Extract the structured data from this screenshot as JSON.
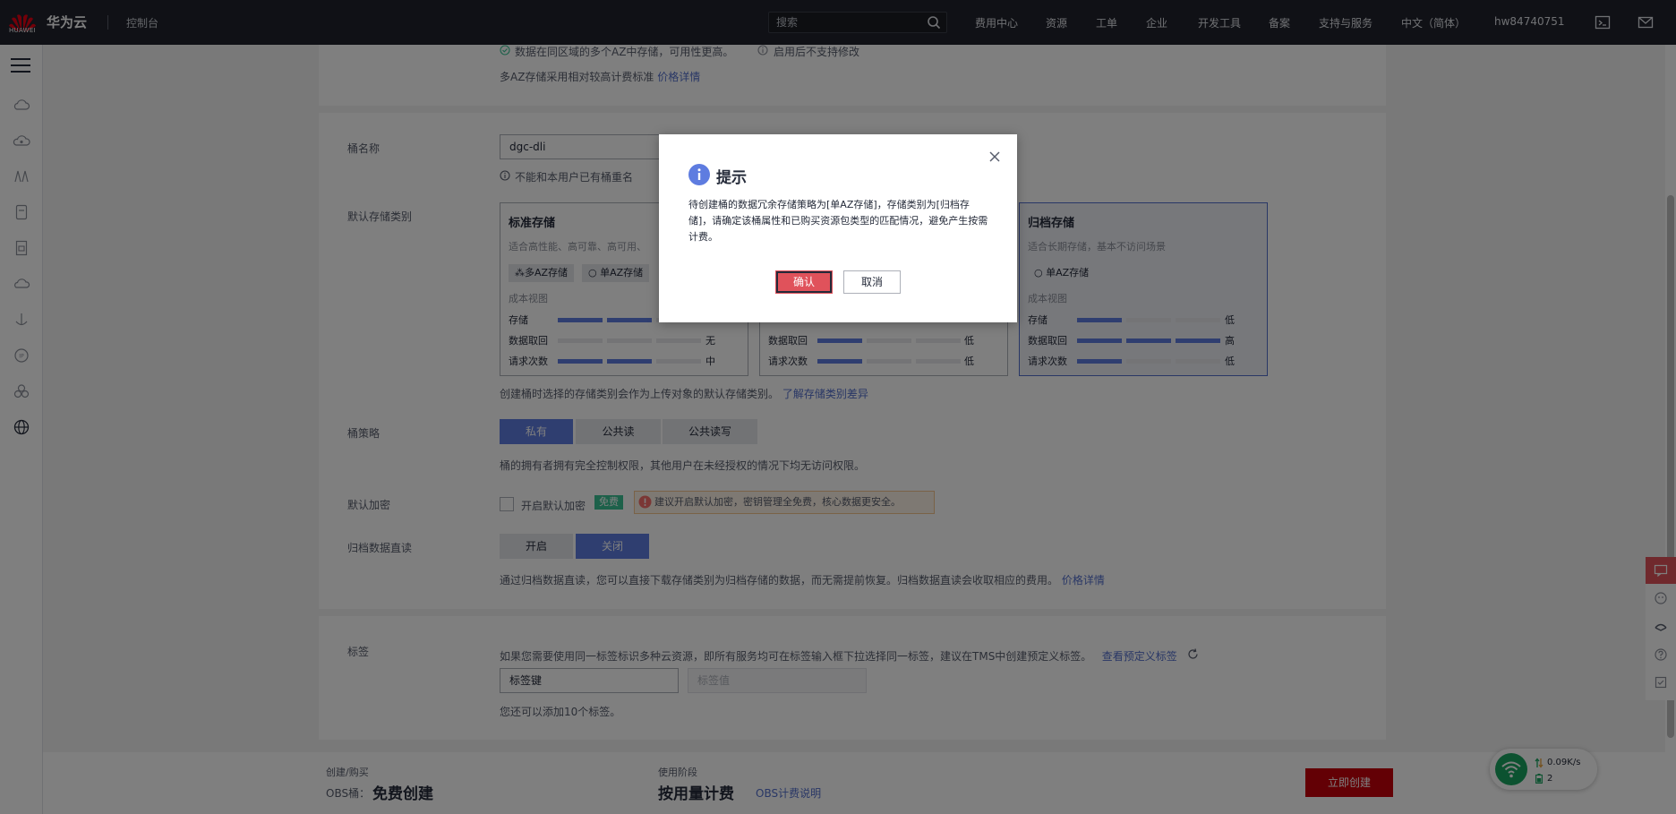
{
  "topbar": {
    "brand": "华为云",
    "logo_word": "HUAWEI",
    "console": "控制台",
    "search_placeholder": "搜索",
    "nav": [
      "费用中心",
      "资源",
      "工单",
      "企业",
      "开发工具",
      "备案",
      "支持与服务",
      "中文（简体）",
      "hw84740751"
    ]
  },
  "form": {
    "az_note_ok": "数据在同区域的多个AZ中存储，可用性更高。",
    "az_note_info": "启用后不支持修改",
    "az_price_note": "多AZ存储采用相对较高计费标准",
    "price_detail": "价格详情",
    "bucket_name_label": "桶名称",
    "bucket_name_value": "dgc-dli",
    "bucket_name_hint": "不能和本用户已有桶重名",
    "storage_class_label": "默认存储类别",
    "storage_class_note": "创建桶时选择的存储类别会作为上传对象的默认存储类别。",
    "storage_class_link": "了解存储类别差异",
    "policy_label": "桶策略",
    "policy_options": [
      "私有",
      "公共读",
      "公共读写"
    ],
    "policy_note": "桶的拥有者拥有完全控制权限，其他用户在未经授权的情况下均无访问权限。",
    "encrypt_label": "默认加密",
    "encrypt_checkbox": "开启默认加密",
    "encrypt_free": "免费",
    "encrypt_warn": "建议开启默认加密，密钥管理全免费，核心数据更安全。",
    "archive_label": "归档数据直读",
    "archive_options": [
      "开启",
      "关闭"
    ],
    "archive_note": "通过归档数据直读，您可以直接下载存储类别为归档存储的数据，而无需提前恢复。归档数据直读会收取相应的费用。",
    "tags_label": "标签",
    "tags_note": "如果您需要使用同一标签标识多种云资源，即所有服务均可在标签输入框下拉选择同一标签，建议在TMS中创建预定义标签。",
    "tags_link": "查看预定义标签",
    "tag_key_placeholder": "标签键",
    "tag_value_placeholder": "标签值",
    "tags_limit": "您还可以添加10个标签。"
  },
  "cards": {
    "standard": {
      "title": "标准存储",
      "sub": "适合高性能、高可靠、高可用、",
      "chips": [
        "多AZ存储",
        "单AZ存储"
      ],
      "cost_title": "成本视图",
      "rows": [
        {
          "label": "存储",
          "level": "",
          "fill": 0.67
        },
        {
          "label": "数据取回",
          "level": "无",
          "fill": 0
        },
        {
          "label": "请求次数",
          "level": "中",
          "fill": 0.67
        }
      ]
    },
    "middle": {
      "rows": [
        {
          "label": "数据取回",
          "level": "低",
          "fill": 0.33
        },
        {
          "label": "请求次数",
          "level": "低",
          "fill": 0.33
        }
      ]
    },
    "archive": {
      "title": "归档存储",
      "sub": "适合长期存储，基本不访问场景",
      "chips": [
        "单AZ存储"
      ],
      "cost_title": "成本视图",
      "rows": [
        {
          "label": "存储",
          "level": "低",
          "fill": 0.33
        },
        {
          "label": "数据取回",
          "level": "高",
          "fill": 1
        },
        {
          "label": "请求次数",
          "level": "低",
          "fill": 0.33
        }
      ]
    }
  },
  "dialog": {
    "title": "提示",
    "body": "待创建桶的数据冗余存储策略为[单AZ存储]，存储类别为[归档存储]，请确定该桶属性和已购买资源包类型的匹配情况，避免产生按需计费。",
    "confirm": "确认",
    "cancel": "取消"
  },
  "footer": {
    "create_label": "创建/购买",
    "obs_label": "OBS桶：",
    "obs_value": "免费创建",
    "usage_label": "使用阶段",
    "usage_value": "按用量计费",
    "billing_link": "OBS计费说明",
    "buy_button": "立即创建"
  },
  "network": {
    "speed": "0.09K/s",
    "count": "2"
  },
  "colors": {
    "accent": "#5e7ce0",
    "danger": "#e0525b",
    "brand_red": "#c7000b"
  }
}
